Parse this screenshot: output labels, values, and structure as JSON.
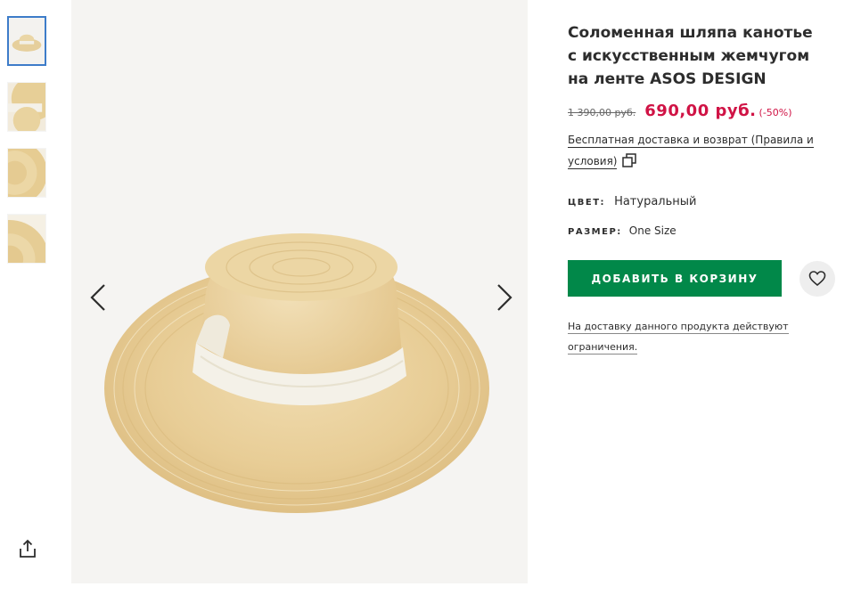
{
  "product": {
    "title": "Соломенная шляпа канотье с искусственным жемчугом на ленте ASOS DESIGN",
    "old_price": "1 390,00 руб.",
    "price": "690,00 руб.",
    "discount": "(-50%)",
    "delivery_text": "Бесплатная доставка и возврат (Правила и условия)",
    "color_label": "ЦВЕТ:",
    "color_value": "Натуральный",
    "size_label": "РАЗМЕР:",
    "size_value": "One Size",
    "add_to_cart": "ДОБАВИТЬ В КОРЗИНУ",
    "restriction_text": "На доставку данного продукта действуют ограничения."
  },
  "colors": {
    "accent_green": "#018849",
    "price_red": "#d01345",
    "thumb_active_border": "#3d7cc9"
  },
  "icons": [
    "share-icon",
    "chevron-left-icon",
    "chevron-right-icon",
    "copy-icon",
    "heart-icon"
  ]
}
